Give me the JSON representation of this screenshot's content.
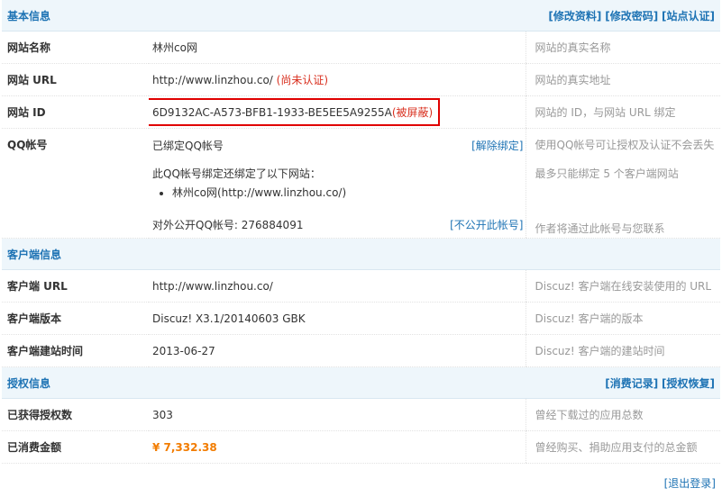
{
  "basic": {
    "title": "基本信息",
    "links": [
      "[修改资料]",
      "[修改密码]",
      "[站点认证]"
    ],
    "site_name": {
      "label": "网站名称",
      "value": "林州co网",
      "desc": "网站的真实名称"
    },
    "site_url": {
      "label": "网站 URL",
      "value": "http://www.linzhou.co/",
      "note": "(尚未认证)",
      "desc": "网站的真实地址"
    },
    "site_id": {
      "label": "网站 ID",
      "value": "6D9132AC-A573-BFB1-1933-BE5EE5A9255A",
      "note": "(被屏蔽)",
      "desc": "网站的 ID，与网站 URL 绑定"
    },
    "qq": {
      "label": "QQ帐号",
      "bound": "已绑定QQ帐号",
      "unbind": "[解除绑定]",
      "desc1": "使用QQ帐号可让授权及认证不会丢失",
      "also_bound": "此QQ帐号绑定还绑定了以下网站：",
      "site_item": "林州co网(http://www.linzhou.co/)",
      "desc2": "最多只能绑定 5 个客户端网站",
      "public": "对外公开QQ帐号: 276884091",
      "hide_link": "[不公开此帐号]",
      "desc3": "作者将通过此帐号与您联系"
    }
  },
  "client": {
    "title": "客户端信息",
    "url": {
      "label": "客户端 URL",
      "value": "http://www.linzhou.co/",
      "desc": "Discuz! 客户端在线安装使用的 URL"
    },
    "version": {
      "label": "客户端版本",
      "value": "Discuz! X3.1/20140603 GBK",
      "desc": "Discuz! 客户端的版本"
    },
    "created": {
      "label": "客户端建站时间",
      "value": "2013-06-27",
      "desc": "Discuz! 客户端的建站时间"
    }
  },
  "license": {
    "title": "授权信息",
    "links": [
      "[消费记录]",
      "[授权恢复]"
    ],
    "count": {
      "label": "已获得授权数",
      "value": "303",
      "desc": "曾经下载过的应用总数"
    },
    "spent": {
      "label": "已消费金额",
      "value": "¥ 7,332.38",
      "desc": "曾经购买、捐助应用支付的总金额"
    }
  },
  "footer": {
    "logout": "[退出登录]"
  },
  "colors": {
    "section_bg": "#eef6fb",
    "link": "#1e73b4",
    "red": "#d9301f",
    "amount": "#f27c00",
    "highlight_box": "#e00000"
  }
}
